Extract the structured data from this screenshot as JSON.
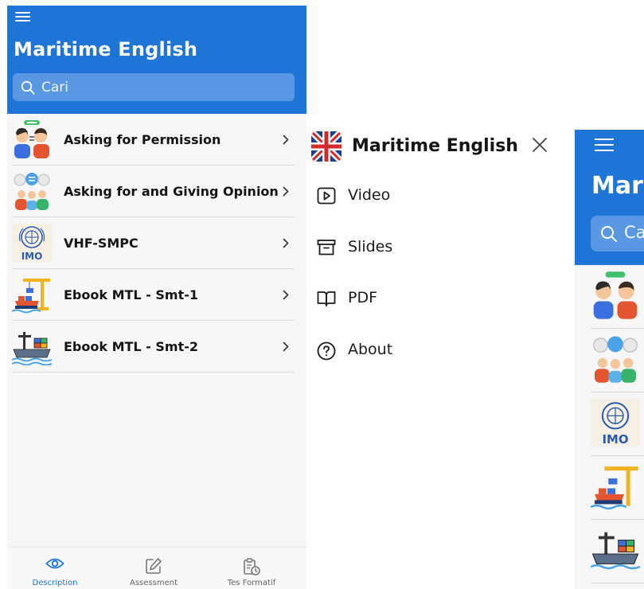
{
  "app": {
    "title": "Maritime English",
    "search_placeholder": "Cari"
  },
  "colors": {
    "primary": "#1f74d8",
    "search_bg": "#5a97e3",
    "active_nav": "#1f74d8"
  },
  "list": {
    "items": [
      {
        "label": "Asking for Permission",
        "icon": "permission-people-icon"
      },
      {
        "label": "Asking for and Giving Opinion",
        "icon": "opinion-people-icon"
      },
      {
        "label": "VHF-SMPC",
        "icon": "imo-logo-icon"
      },
      {
        "label": "Ebook MTL - Smt-1",
        "icon": "crane-ship-icon"
      },
      {
        "label": "Ebook MTL - Smt-2",
        "icon": "port-ship-icon"
      }
    ]
  },
  "bottom_nav": {
    "items": [
      {
        "label": "Description",
        "icon": "eye-icon",
        "active": true
      },
      {
        "label": "Assessment",
        "icon": "edit-icon",
        "active": false
      },
      {
        "label": "Tes Formatif",
        "icon": "clipboard-clock-icon",
        "active": false
      }
    ]
  },
  "drawer": {
    "title": "Maritime English",
    "flag_icon": "uk-flag-icon",
    "items": [
      {
        "label": "Video",
        "icon": "play-icon"
      },
      {
        "label": "Slides",
        "icon": "archive-icon"
      },
      {
        "label": "PDF",
        "icon": "book-icon"
      },
      {
        "label": "About",
        "icon": "help-circle-icon"
      }
    ]
  },
  "right_screen": {
    "title_partial": "Marit",
    "search_partial": "Ca"
  }
}
